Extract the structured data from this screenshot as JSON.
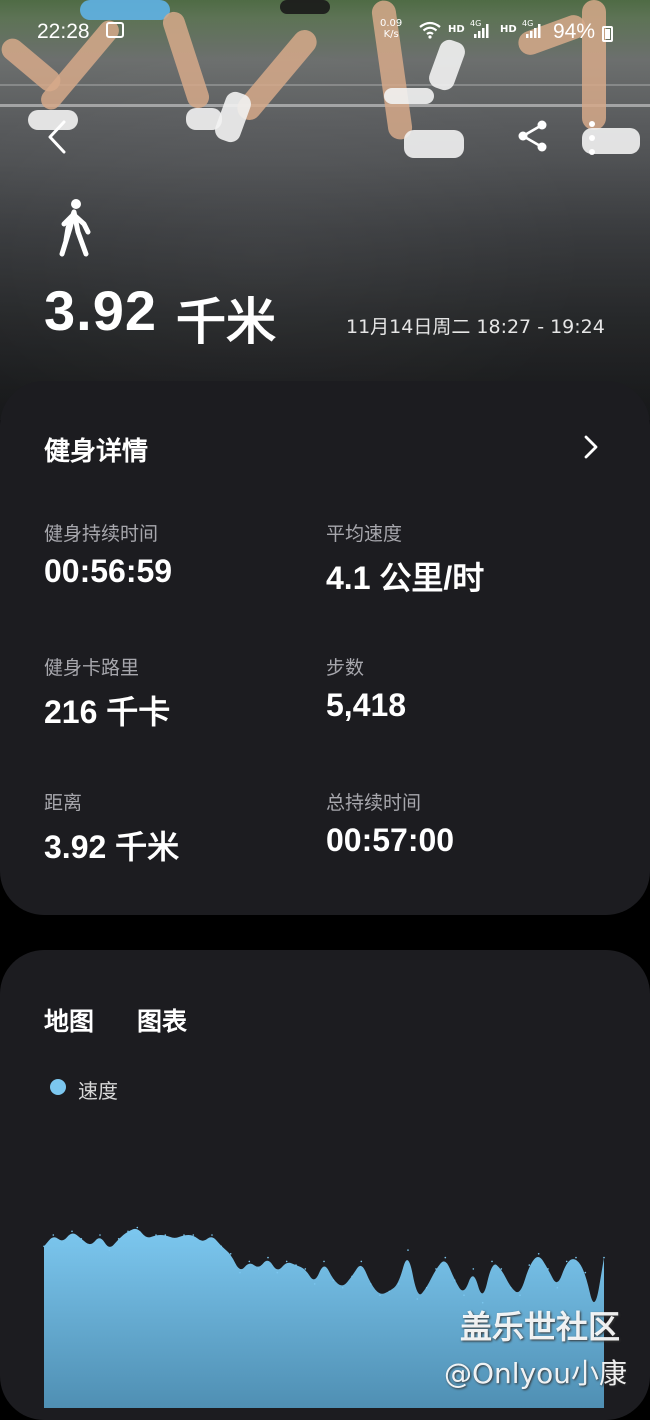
{
  "status_bar": {
    "time": "22:28",
    "net_speed_value": "0.09",
    "net_speed_unit": "K/s",
    "hd1": "HD",
    "hd2": "HD",
    "battery": "94%"
  },
  "hero": {
    "activity_icon": "walk-icon",
    "distance": "3.92",
    "distance_unit": "千米",
    "datetime": "11月14日周二 18:27 - 19:24"
  },
  "details_card": {
    "title": "健身详情",
    "metrics": [
      {
        "label": "健身持续时间",
        "value": "00:56:59"
      },
      {
        "label": "平均速度",
        "value": "4.1 公里/时"
      },
      {
        "label": "健身卡路里",
        "value": "216 千卡"
      },
      {
        "label": "步数",
        "value": "5,418"
      },
      {
        "label": "距离",
        "value": "3.92 千米"
      },
      {
        "label": "总持续时间",
        "value": "00:57:00"
      }
    ]
  },
  "chart_card": {
    "tabs": [
      "地图",
      "图表"
    ],
    "legend": "速度"
  },
  "chart_data": {
    "type": "area",
    "series": [
      {
        "name": "速度",
        "color": "#7cc7ef",
        "values": [
          4.3,
          4.6,
          4.4,
          4.7,
          4.5,
          4.3,
          4.6,
          4.2,
          4.5,
          4.7,
          4.8,
          4.5,
          4.6,
          4.6,
          4.5,
          4.6,
          4.6,
          4.4,
          4.6,
          4.3,
          4.1,
          3.6,
          3.9,
          3.7,
          4.0,
          3.6,
          3.9,
          3.8,
          3.7,
          3.3,
          3.9,
          3.4,
          3.2,
          3.5,
          3.9,
          3.3,
          3.0,
          3.1,
          3.3,
          4.2,
          2.9,
          3.2,
          3.7,
          4.0,
          3.4,
          3.0,
          3.7,
          2.8,
          3.9,
          3.7,
          3.2,
          3.0,
          3.8,
          4.1,
          3.7,
          3.2,
          3.9,
          4.0,
          3.6,
          2.5,
          4.0
        ]
      }
    ]
  },
  "watermark": {
    "line1": "盖乐世社区",
    "line2": "@Onlyou小康"
  },
  "colors": {
    "card_bg": "#1c1c20",
    "accent": "#7cc7ef",
    "label_grey": "#a7a7ad"
  }
}
